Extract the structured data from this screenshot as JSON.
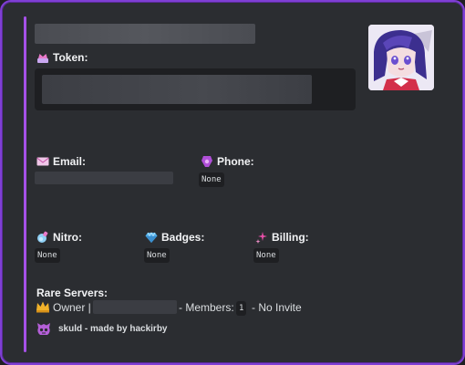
{
  "token": {
    "label": "Token:"
  },
  "email": {
    "label": "Email:"
  },
  "phone": {
    "label": "Phone:",
    "value": "None"
  },
  "nitro": {
    "label": "Nitro:",
    "value": "None"
  },
  "badges": {
    "label": "Badges:",
    "value": "None"
  },
  "billing": {
    "label": "Billing:",
    "value": "None"
  },
  "rare_servers": {
    "label": "Rare Servers:",
    "owner_prefix": "Owner |",
    "members_label": "- Members:",
    "members_count": "1",
    "invite_text": "- No Invite"
  },
  "footer": {
    "text": "skuld - made by hackirby"
  },
  "colors": {
    "accent": "#a651e8",
    "border": "#7f3fd4",
    "background": "#2b2d31"
  },
  "icons": {
    "token": "crown-badge-icon",
    "email": "envelope-icon",
    "phone": "phone-icon",
    "nitro": "nitro-potion-icon",
    "badges": "gem-icon",
    "billing": "sparkles-icon",
    "owner": "crown-icon",
    "footer": "skuld-logo-icon"
  }
}
